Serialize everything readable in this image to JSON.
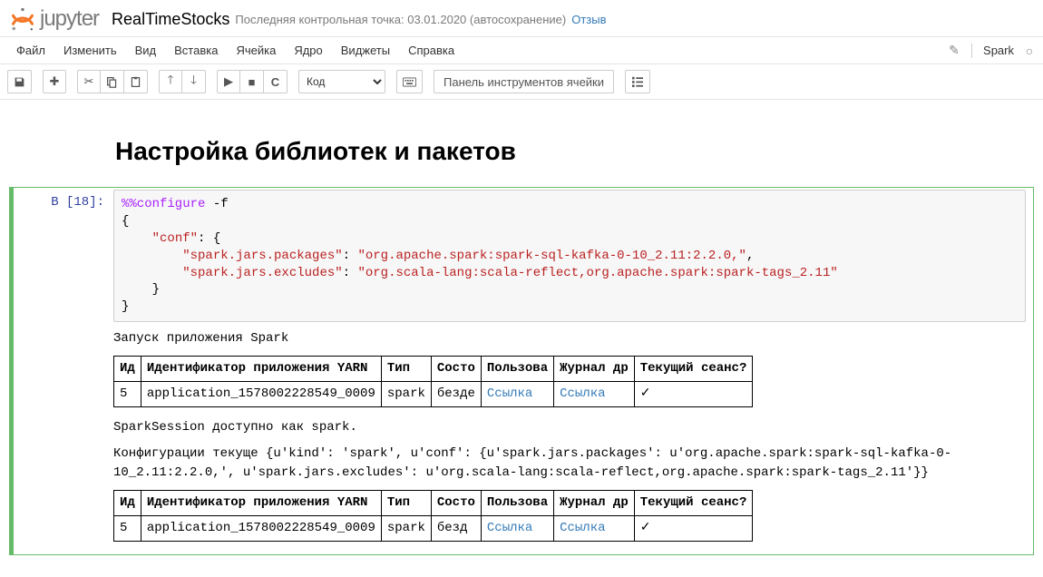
{
  "brand": "jupyter",
  "notebook_name": "RealTimeStocks",
  "checkpoint": "Последняя контрольная точка: 03.01.2020 (автосохранение)",
  "feedback": "Отзыв",
  "menu": {
    "file": "Файл",
    "edit": "Изменить",
    "view": "Вид",
    "insert": "Вставка",
    "cell": "Ячейка",
    "kernel": "Ядро",
    "widgets": "Виджеты",
    "help": "Справка"
  },
  "kernel_name": "Spark",
  "toolbar": {
    "celltype": "Код",
    "celltoolbar": "Панель инструментов ячейки"
  },
  "heading": "Настройка библиотек и пакетов",
  "cell1": {
    "prompt": "В [18]:",
    "code": {
      "l1_magic": "%%configure",
      "l1_rest": " -f",
      "l2": "{",
      "l3_k": "\"conf\"",
      "l3_r": ": {",
      "l4_k": "\"spark.jars.packages\"",
      "l4_v": "\"org.apache.spark:spark-sql-kafka-0-10_2.11:2.2.0,\"",
      "l5_k": "\"spark.jars.excludes\"",
      "l5_v": "\"org.scala-lang:scala-reflect,org.apache.spark:spark-tags_2.11\"",
      "l6": "    }",
      "l7": "}"
    },
    "out1": "Запуск приложения Spark",
    "table_headers": {
      "id": "Ид",
      "yarn": "Идентификатор приложения YARN",
      "type": "Тип",
      "state": "Состо",
      "user": "Пользова",
      "driver": "Журнал др",
      "current": "Текущий сеанс?"
    },
    "row": {
      "id": "5",
      "yarn": "application_1578002228549_0009",
      "type": "spark",
      "state": "безде",
      "user": "Ссылка",
      "driver": "Ссылка",
      "current": "✓"
    },
    "row2_state": "безд",
    "out2": "SparkSession доступно как spark.",
    "out3": "Конфигурации текуще {u'kind': 'spark', u'conf': {u'spark.jars.packages': u'org.apache.spark:spark-sql-kafka-0-10_2.11:2.2.0,', u'spark.jars.excludes': u'org.scala-lang:scala-reflect,org.apache.spark:spark-tags_2.11'}}"
  }
}
